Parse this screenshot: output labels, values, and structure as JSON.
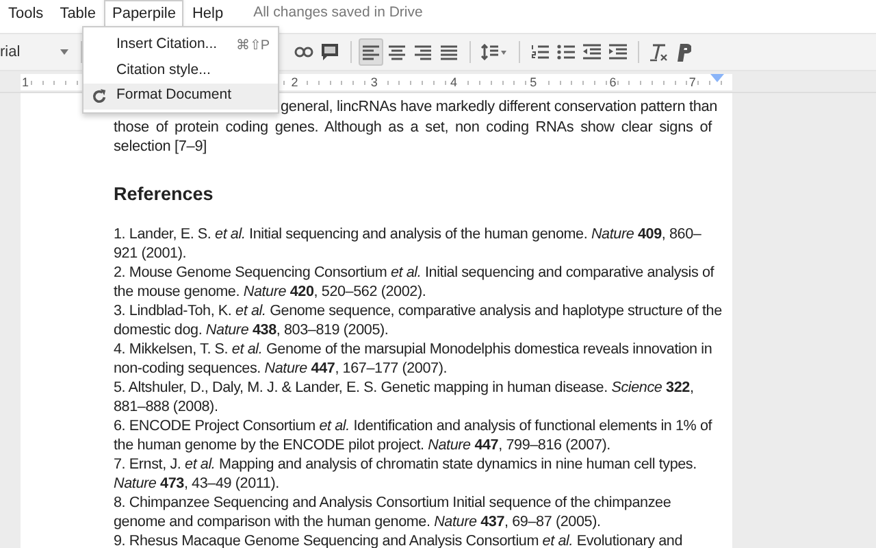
{
  "menubar": {
    "items": [
      {
        "label": "Tools",
        "selected": false
      },
      {
        "label": "Table",
        "selected": false
      },
      {
        "label": "Paperpile",
        "selected": true
      },
      {
        "label": "Help",
        "selected": false
      }
    ],
    "status": "All changes saved in Drive"
  },
  "toolbar": {
    "font": "rial",
    "items": [
      {
        "kind": "link"
      },
      {
        "kind": "comment"
      },
      {
        "kind": "divider"
      },
      {
        "kind": "align-left",
        "selected": true
      },
      {
        "kind": "align-center",
        "selected": false
      },
      {
        "kind": "align-right",
        "selected": false
      },
      {
        "kind": "align-justify",
        "selected": false
      },
      {
        "kind": "divider"
      },
      {
        "kind": "line-spacing"
      },
      {
        "kind": "divider"
      },
      {
        "kind": "numbered-list"
      },
      {
        "kind": "bulleted-list"
      },
      {
        "kind": "indent-decrease"
      },
      {
        "kind": "indent-increase"
      },
      {
        "kind": "divider"
      },
      {
        "kind": "clear-format"
      },
      {
        "kind": "paperpile"
      }
    ]
  },
  "ruler": {
    "numbers": [
      "1",
      "2",
      "3",
      "4",
      "5",
      "6",
      "7"
    ]
  },
  "dropdown": {
    "items": [
      {
        "label": "Insert Citation...",
        "shortcut": "⌘⇧P",
        "highlighted": false
      },
      {
        "label": "Citation style...",
        "highlighted": false
      },
      {
        "label": "Format Document",
        "highlighted": true
      }
    ]
  },
  "document": {
    "paragraph_lines": [
      "general, lincRNAs have markedly different conservation pattern than",
      "those of protein coding genes. Although as a set, non coding RNAs show clear signs of selection [7–9]"
    ],
    "heading": "References",
    "references": [
      "1. Lander, E. S. *et al.* Initial sequencing and analysis of the human genome. *Nature* **409**, 860–921 (2001).",
      "2. Mouse Genome Sequencing Consortium *et al.* Initial sequencing and comparative analysis of the mouse genome. *Nature* **420**, 520–562 (2002).",
      "3. Lindblad-Toh, K. *et al.* Genome sequence, comparative analysis and haplotype structure of the domestic dog. *Nature* **438**, 803–819 (2005).",
      "4. Mikkelsen, T. S. *et al.* Genome of the marsupial Monodelphis domestica reveals innovation in non-coding sequences. *Nature* **447**, 167–177 (2007).",
      "5. Altshuler, D., Daly, M. J. & Lander, E. S. Genetic mapping in human disease. *Science* **322**, 881–888 (2008).",
      "6. ENCODE Project Consortium *et al.* Identification and analysis of functional elements in 1% of the human genome by the ENCODE pilot project. *Nature* **447**, 799–816 (2007).",
      "7. Ernst, J. *et al.* Mapping and analysis of chromatin state dynamics in nine human cell types. *Nature* **473**, 43–49 (2011).",
      "8. Chimpanzee Sequencing and Analysis Consortium Initial sequence of the chimpanzee genome and comparison with the human genome. *Nature* **437**, 69–87 (2005).",
      "9. Rhesus Macaque Genome Sequencing and Analysis Consortium *et al.* Evolutionary and"
    ]
  }
}
